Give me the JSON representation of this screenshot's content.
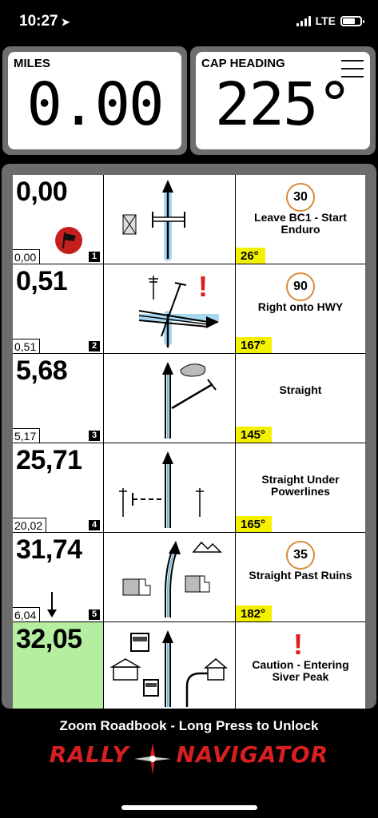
{
  "status": {
    "time": "10:27",
    "carrier": "LTE"
  },
  "gauges": {
    "miles": {
      "label": "MILES",
      "value": "0.00"
    },
    "cap": {
      "label": "CAP HEADING",
      "value": "225°"
    }
  },
  "rows": [
    {
      "total": "0,00",
      "partial": "0,00",
      "num": "1",
      "speed": "30",
      "instruction": "Leave BC1 - Start Enduro",
      "heading": "26°"
    },
    {
      "total": "0,51",
      "partial": "0,51",
      "num": "2",
      "speed": "90",
      "instruction": "Right onto HWY",
      "heading": "167°"
    },
    {
      "total": "5,68",
      "partial": "5,17",
      "num": "3",
      "instruction": "Straight",
      "heading": "145°"
    },
    {
      "total": "25,71",
      "partial": "20,02",
      "num": "4",
      "instruction": "Straight Under Powerlines",
      "heading": "165°"
    },
    {
      "total": "31,74",
      "partial": "6,04",
      "num": "5",
      "speed": "35",
      "instruction": "Straight Past Ruins",
      "heading": "182°"
    },
    {
      "total": "32,05",
      "instruction": "Caution - Entering Siver Peak"
    }
  ],
  "footer": {
    "hint": "Zoom Roadbook - Long Press to Unlock",
    "brand_left": "RALLY",
    "brand_right": "NAVIGATOR"
  },
  "colors": {
    "highlight": "#b5eea0",
    "heading_bg": "#f3f000",
    "track": "#a8d8f0",
    "alert": "#e01b1b"
  }
}
